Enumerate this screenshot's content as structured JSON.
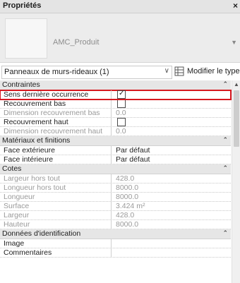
{
  "panel": {
    "title": "Propriétés",
    "close_label": "×"
  },
  "type_selector": {
    "type_name": "AMC_Produit",
    "arrow": "▼"
  },
  "filter": {
    "label": "Panneaux de murs-rideaux (1)",
    "arrow": "∨"
  },
  "edit_type": {
    "label": "Modifier le type"
  },
  "groups": {
    "contraintes": "Contraintes",
    "materiaux": "Matériaux et finitions",
    "cotes": "Cotes",
    "identification": "Données d'identification"
  },
  "rows": {
    "sens_derniere": {
      "name": "Sens dernière occurrence",
      "checked": "✓"
    },
    "recouvrement_bas": {
      "name": "Recouvrement bas"
    },
    "dimension_rec_bas": {
      "name": "Dimension recouvrement bas",
      "value": "0.0"
    },
    "recouvrement_haut": {
      "name": "Recouvrement haut"
    },
    "dimension_rec_haut": {
      "name": "Dimension recouvrement haut",
      "value": "0.0"
    },
    "face_ext": {
      "name": "Face extérieure",
      "value": "Par défaut"
    },
    "face_int": {
      "name": "Face intérieure",
      "value": "Par défaut"
    },
    "largeur_hors_tout": {
      "name": "Largeur hors tout",
      "value": "428.0"
    },
    "longueur_hors_tout": {
      "name": "Longueur hors tout",
      "value": "8000.0"
    },
    "longueur": {
      "name": "Longueur",
      "value": "8000.0"
    },
    "surface": {
      "name": "Surface",
      "value": "3.424 m²"
    },
    "largeur": {
      "name": "Largeur",
      "value": "428.0"
    },
    "hauteur": {
      "name": "Hauteur",
      "value": "8000.0"
    },
    "image": {
      "name": "Image",
      "value": ""
    },
    "commentaires": {
      "name": "Commentaires",
      "value": ""
    }
  },
  "icons": {
    "collapse": "⌃",
    "scroll_up": "▲"
  },
  "colors": {
    "highlight": "#d71920",
    "group_bg": "#e6e6e6"
  }
}
